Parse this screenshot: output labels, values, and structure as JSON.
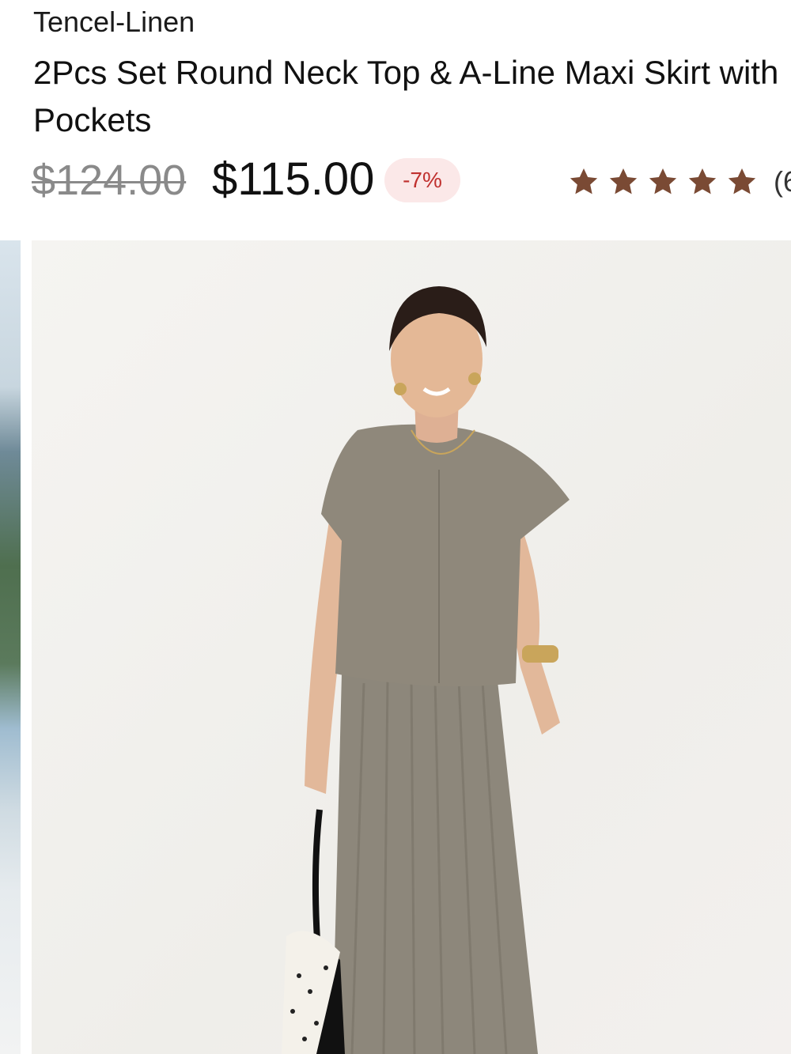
{
  "product": {
    "category": "Tencel-Linen",
    "title": "2Pcs Set Round Neck Top & A-Line Maxi Skirt with Pockets",
    "original_price": "$124.00",
    "sale_price": "$115.00",
    "discount": "-7%",
    "rating_stars": 5,
    "rating_count": "(6"
  },
  "colors": {
    "star": "#7a4a34",
    "discount_text": "#c0302e",
    "discount_bg": "#fbe8e8",
    "old_price": "#8a8a8a"
  },
  "gallery": {
    "main_image_icon": "product-photo-icon",
    "prev_image_icon": "previous-photo-icon"
  }
}
